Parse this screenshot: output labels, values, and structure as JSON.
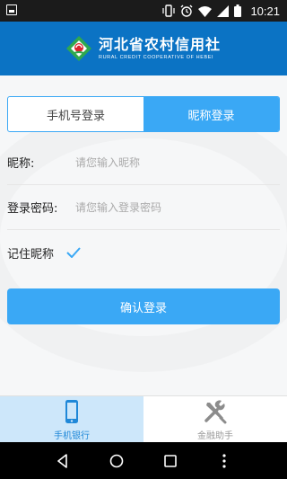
{
  "status_bar": {
    "time": "10:21",
    "icons": [
      "notification-icon",
      "vibrate-icon",
      "alarm-icon",
      "wifi-icon",
      "signal-icon",
      "battery-icon"
    ]
  },
  "header": {
    "title_cn": "河北省农村信用社",
    "title_en": "RURAL CREDIT COOPERATIVE OF HEBEI",
    "brand_color": "#0b73c4"
  },
  "login_tabs": [
    {
      "label": "手机号登录",
      "active": false
    },
    {
      "label": "昵称登录",
      "active": true
    }
  ],
  "form": {
    "nickname_label": "昵称:",
    "nickname_placeholder": "请您输入昵称",
    "password_label": "登录密码:",
    "password_placeholder": "请您输入登录密码",
    "remember_label": "记住昵称",
    "remember_checked": true,
    "confirm_label": "确认登录"
  },
  "bottom_nav": [
    {
      "label": "手机银行",
      "icon": "phone-icon",
      "active": true
    },
    {
      "label": "金融助手",
      "icon": "tools-icon",
      "active": false
    }
  ],
  "colors": {
    "accent": "#3aa8f5",
    "header": "#0b73c4",
    "nav_active_bg": "#cde7fa"
  }
}
